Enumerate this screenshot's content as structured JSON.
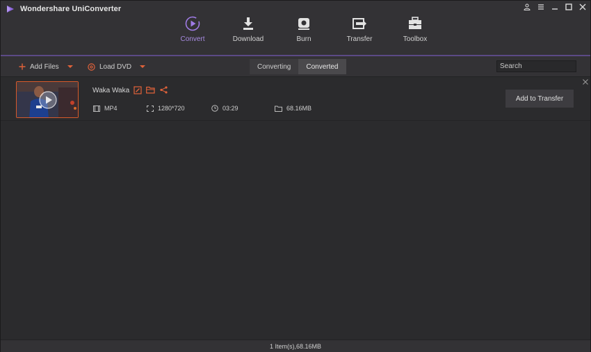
{
  "app": {
    "title": "Wondershare UniConverter",
    "accent": "#a07ce6",
    "orange": "#e0623a"
  },
  "window_controls": [
    {
      "name": "account-icon"
    },
    {
      "name": "menu-icon"
    },
    {
      "name": "minimize-icon"
    },
    {
      "name": "maximize-icon"
    },
    {
      "name": "close-icon"
    }
  ],
  "nav": {
    "items": [
      {
        "label": "Convert",
        "icon": "convert-icon",
        "active": true
      },
      {
        "label": "Download",
        "icon": "download-icon",
        "active": false
      },
      {
        "label": "Burn",
        "icon": "burn-icon",
        "active": false
      },
      {
        "label": "Transfer",
        "icon": "transfer-icon",
        "active": false
      },
      {
        "label": "Toolbox",
        "icon": "toolbox-icon",
        "active": false
      }
    ]
  },
  "toolbar": {
    "add_files": "Add Files",
    "load_dvd": "Load DVD",
    "tabs": [
      {
        "label": "Converting",
        "active": false
      },
      {
        "label": "Converted",
        "active": true
      }
    ],
    "search_placeholder": "Search"
  },
  "files": [
    {
      "name": "Waka Waka",
      "format": "MP4",
      "resolution": "1280*720",
      "duration": "03:29",
      "size": "68.16MB",
      "action_label": "Add to Transfer"
    }
  ],
  "status": {
    "text": "1 Item(s),68.16MB"
  }
}
